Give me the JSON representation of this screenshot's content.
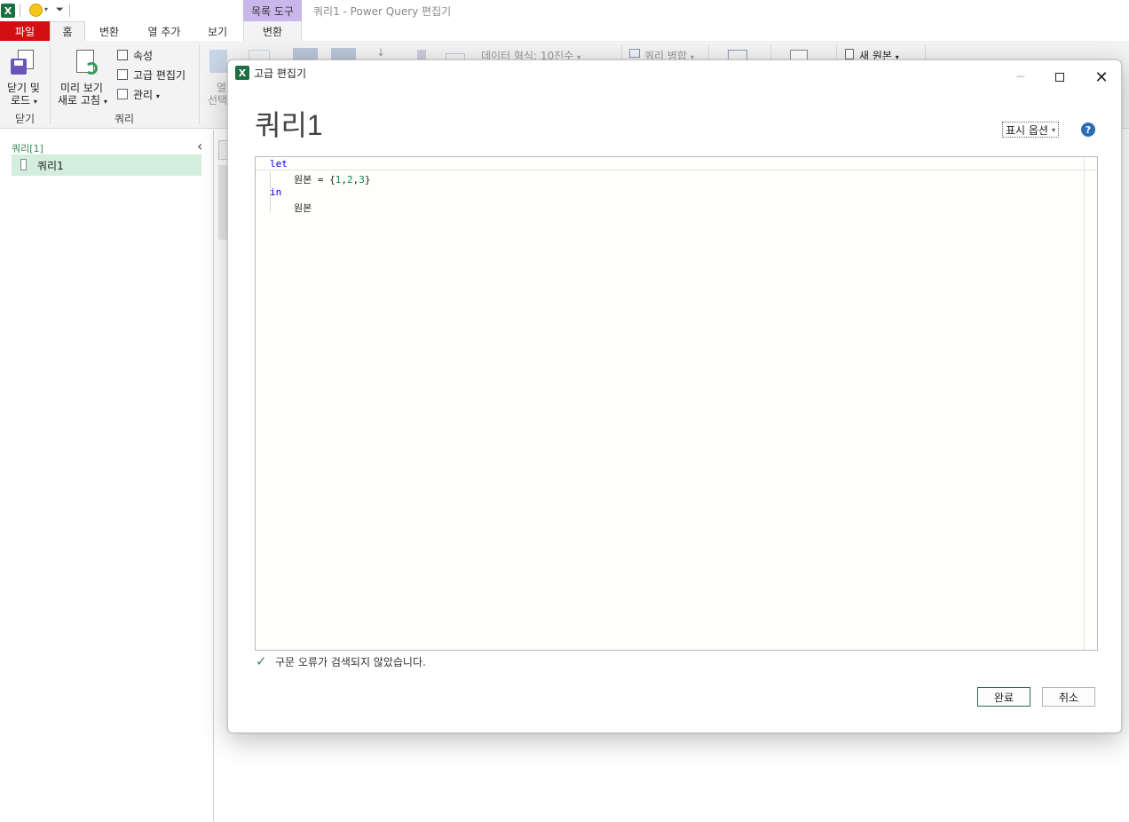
{
  "titlebar": {
    "app_logo": "X",
    "context_tab_header": "목록 도구",
    "window_title": "쿼리1 - Power Query 편집기"
  },
  "tabs": {
    "file": "파일",
    "home": "홈",
    "transform": "변환",
    "add_column": "열 추가",
    "view": "보기",
    "context_transform": "변환"
  },
  "ribbon": {
    "close_load_line1": "닫기 및",
    "close_load_line2": "로드",
    "close_group": "닫기",
    "preview_line1": "미리 보기",
    "preview_line2": "새로 고침",
    "properties": "속성",
    "advanced_editor": "고급 편집기",
    "manage": "관리",
    "query_group": "쿼리",
    "col_line1": "열",
    "col_line2": "선택",
    "data_type": "데이터 형식: 10진수",
    "merge_queries": "쿼리 병합",
    "new_source": "새 원본"
  },
  "leftpane": {
    "header": "쿼리[1]",
    "items": [
      {
        "label": "쿼리1"
      }
    ]
  },
  "dialog": {
    "title": "고급 편집기",
    "query_name": "쿼리1",
    "display_options": "표시 옵션",
    "help": "?",
    "code": {
      "line1_kw": "let",
      "line2_name": "원본",
      "line2_eq": " = ",
      "line2_open": "{",
      "line2_n1": "1",
      "line2_n2": "2",
      "line2_n3": "3",
      "line2_comma": ",",
      "line2_close": "}",
      "line3_kw": "in",
      "line4_name": "원본"
    },
    "status": "구문 오류가 검색되지 않았습니다.",
    "done": "완료",
    "cancel": "취소"
  },
  "colors": {
    "file_tab": "#d40f14",
    "context_header": "#c9b7ec",
    "excel_green": "#1d6f42",
    "selected_query": "#d3eedd",
    "keyword": "#0000ff",
    "number": "#098658",
    "check": "#3a8a5c"
  }
}
